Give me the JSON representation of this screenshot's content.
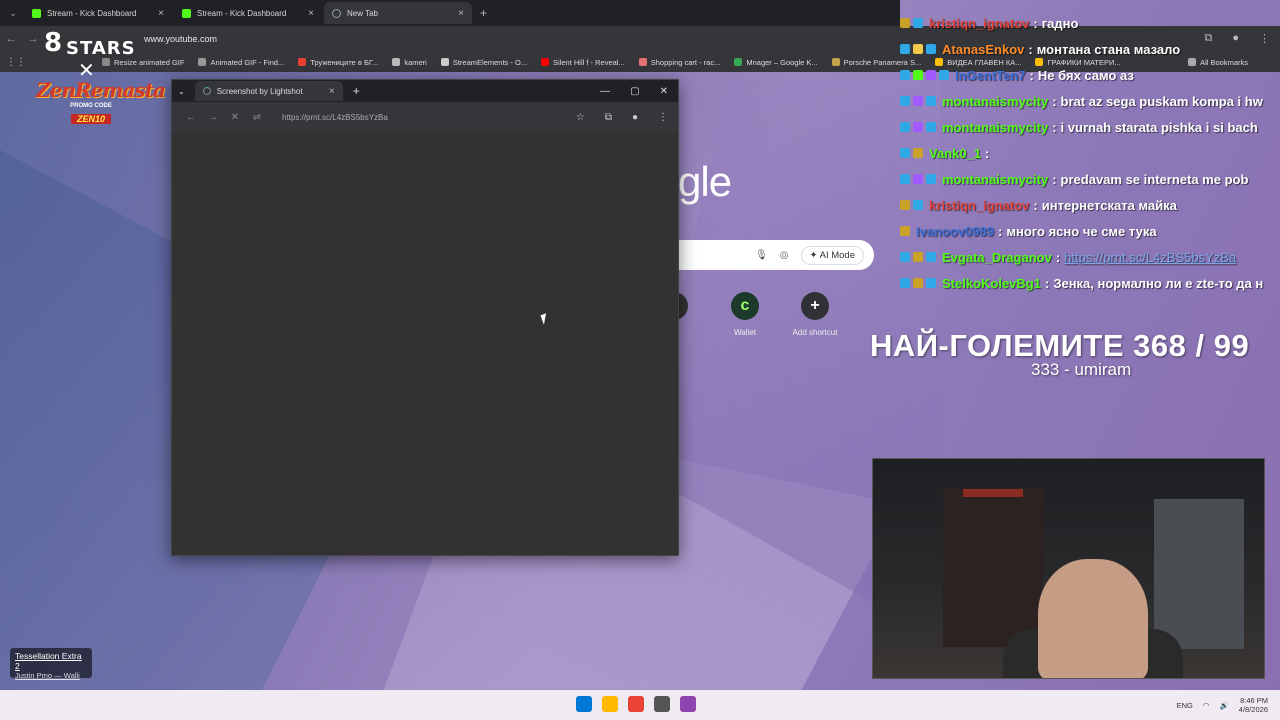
{
  "browser": {
    "tabs": [
      {
        "label": "Stream - Kick Dashboard",
        "color": "#53fc18",
        "active": false
      },
      {
        "label": "Stream - Kick Dashboard",
        "color": "#53fc18",
        "active": false
      },
      {
        "label": "New Tab",
        "color": "#9aa0a6",
        "active": true
      }
    ],
    "url": "www.youtube.com",
    "bookmarks": [
      {
        "label": "Resize animated GIF",
        "color": "#888888"
      },
      {
        "label": "Animated GIF - Find...",
        "color": "#999999"
      },
      {
        "label": "Тружениците в БГ...",
        "color": "#e94235"
      },
      {
        "label": "kameri",
        "color": "#bbbbbb"
      },
      {
        "label": "StreamElements - O...",
        "color": "#cccccc"
      },
      {
        "label": "Silent Hill f - Reveal...",
        "color": "#ff0000"
      },
      {
        "label": "Shopping cart - rac...",
        "color": "#e57373"
      },
      {
        "label": "Mnager – Google K...",
        "color": "#34a853"
      },
      {
        "label": "Porsche Panamera S...",
        "color": "#c2a24a"
      },
      {
        "label": "ВИДЕА ГЛАВЕН КА...",
        "color": "#fbbc04"
      },
      {
        "label": "ГРАФИКИ МАТЕРИ...",
        "color": "#fbbc04"
      }
    ],
    "all_bookmarks": "All Bookmarks"
  },
  "overlay": {
    "logo_num": "8",
    "logo_text": "STARS",
    "promo_brand": "ZenRemasta",
    "promo_label": "PROMO CODE",
    "promo_code": "ZEN10"
  },
  "newtab": {
    "google_partial": "gle",
    "ai_mode": "AI Mode",
    "shortcuts": [
      {
        "label": "Wallet",
        "glyph": "c",
        "bg": "#1b3a2a",
        "fg": "#9cff6a"
      },
      {
        "label": "Add shortcut",
        "glyph": "+",
        "bg": "#303134",
        "fg": "#ffffff"
      }
    ]
  },
  "popup": {
    "tab_title": "Screenshot by Lightshot",
    "url": "https://prnt.sc/L4zBS5bsYzBa"
  },
  "chat": [
    {
      "user": "kristiqn_ignatov",
      "color": "#e0443c",
      "text": "гадно",
      "badges": [
        "#c9a227",
        "#2ea8e6"
      ]
    },
    {
      "user": "AtanasEnkov",
      "color": "#ff8c2a",
      "text": "монтана стана мазало",
      "badges": [
        "#2ea8e6",
        "#f2c94c",
        "#2ea8e6"
      ]
    },
    {
      "user": "InGentTen7",
      "color": "#3b6fd8",
      "text": "Не бях само аз",
      "badges": [
        "#2ea8e6",
        "#53fc18",
        "#a259ff",
        "#2ea8e6"
      ]
    },
    {
      "user": "montanaismycity",
      "color": "#53fc18",
      "text": "brat az sega puskam kompa i hw",
      "badges": [
        "#2ea8e6",
        "#a259ff",
        "#2ea8e6"
      ]
    },
    {
      "user": "montanaismycity",
      "color": "#53fc18",
      "text": "i vurnah starata pishka i si bach",
      "badges": [
        "#2ea8e6",
        "#a259ff",
        "#2ea8e6"
      ]
    },
    {
      "user": "Vank0_1",
      "color": "#53fc18",
      "text": "",
      "badges": [
        "#2ea8e6",
        "#c9a227"
      ]
    },
    {
      "user": "montanaismycity",
      "color": "#53fc18",
      "text": "predavam se interneta me pob",
      "badges": [
        "#2ea8e6",
        "#a259ff",
        "#2ea8e6"
      ]
    },
    {
      "user": "kristiqn_ignatov",
      "color": "#e0443c",
      "text": "интернетската майка",
      "badges": [
        "#c9a227",
        "#2ea8e6"
      ]
    },
    {
      "user": "Ivanoov0989",
      "color": "#3b6fd8",
      "text": "много ясно че сме тука",
      "badges": [
        "#c9a227"
      ]
    },
    {
      "user": "Evgata_Draganov",
      "color": "#53fc18",
      "text": "https://prnt.sc/L4zBS5bsYzBa",
      "badges": [
        "#2ea8e6",
        "#c9a227",
        "#2ea8e6"
      ],
      "is_link": true
    },
    {
      "user": "StelkoKolevBg1",
      "color": "#53fc18",
      "text": "Зенка, нормално ли е zte-то да н",
      "badges": [
        "#2ea8e6",
        "#c9a227",
        "#2ea8e6"
      ]
    }
  ],
  "goal": {
    "title": "НАЙ-ГОЛЕМИТЕ 368 / 99",
    "subtitle": "333 - umiram"
  },
  "now_playing": {
    "title": "Tessellation Extra 2",
    "artist": "Justin Pmo — Walli"
  },
  "taskbar": {
    "lang": "ENG",
    "time": "8:46 PM",
    "date": "4/8/2026",
    "apps": [
      "#0078d4",
      "#ffb900",
      "#ea4335",
      "#555555",
      "#8e44ad"
    ]
  }
}
